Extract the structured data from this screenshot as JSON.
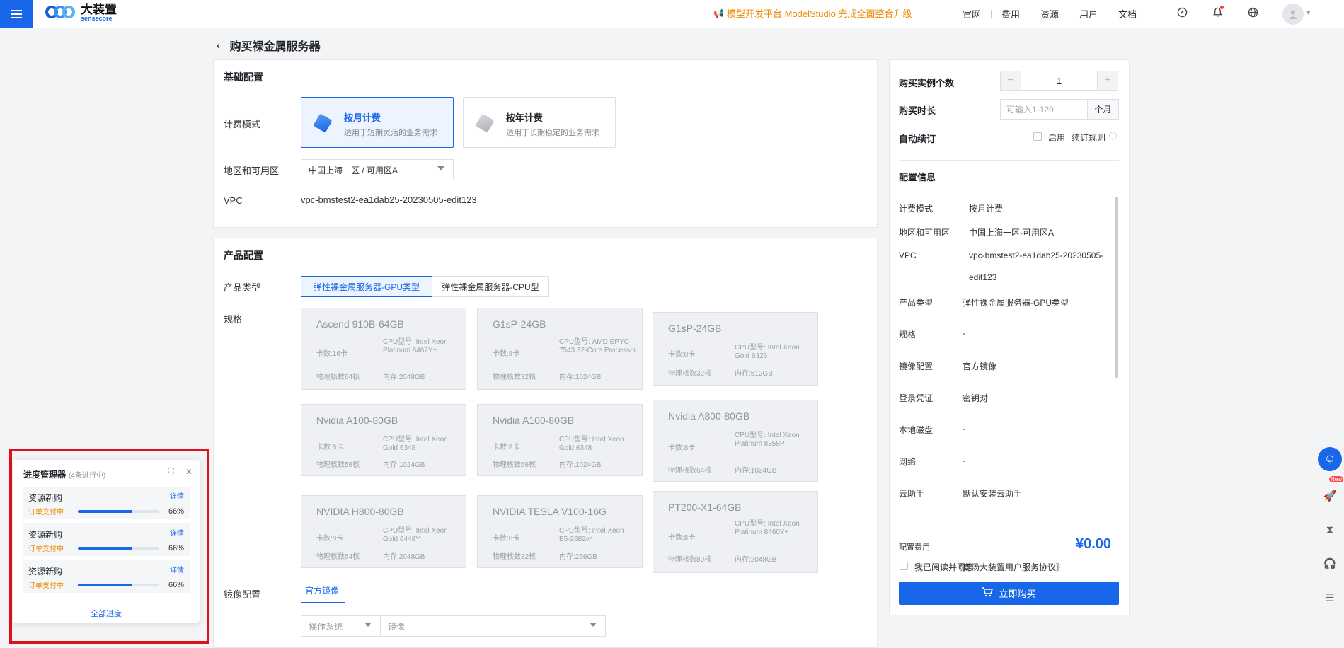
{
  "header": {
    "logo_cn": "大装置",
    "logo_en": "sensecore",
    "announcement": "模型开发平台 ModelStudio 完成全面整合升级",
    "nav": [
      "官网",
      "费用",
      "资源",
      "用户",
      "文档"
    ]
  },
  "page": {
    "title": "购买裸金属服务器"
  },
  "basic": {
    "title": "基础配置",
    "billing_label": "计费模式",
    "monthly_title": "按月计费",
    "monthly_desc": "适用于短期灵活的业务需求",
    "yearly_title": "按年计费",
    "yearly_desc": "适用于长期稳定的业务需求",
    "region_label": "地区和可用区",
    "region_value": "中国上海一区 / 可用区A",
    "vpc_label": "VPC",
    "vpc_value": "vpc-bmstest2-ea1dab25-20230505-edit123"
  },
  "product": {
    "title": "产品配置",
    "type_label": "产品类型",
    "type_gpu": "弹性裸金属服务器-GPU类型",
    "type_cpu": "弹性裸金属服务器-CPU型",
    "spec_label": "规格",
    "specs": [
      {
        "name": "Ascend 910B-64GB",
        "cards": "卡数:16卡",
        "cpu": "CPU型号: Intel Xeon Platinum 8462Y+",
        "cores": "物理核数64核",
        "mem": "内存:2048GB"
      },
      {
        "name": "G1sP-24GB",
        "cards": "卡数:8卡",
        "cpu": "CPU型号: AMD EPYC 7543 32-Core Processor",
        "cores": "物理核数32核",
        "mem": "内存:1024GB"
      },
      {
        "name": "G1sP-24GB",
        "cards": "卡数:8卡",
        "cpu": "CPU型号: Intel Xeon Gold 6326",
        "cores": "物理核数32核",
        "mem": "内存:512GB"
      },
      {
        "name": "Nvidia A100-80GB",
        "cards": "卡数:8卡",
        "cpu": "CPU型号: Intel Xeon Gold 6348",
        "cores": "物理核数56核",
        "mem": "内存:1024GB"
      },
      {
        "name": "Nvidia A100-80GB",
        "cards": "卡数:8卡",
        "cpu": "CPU型号: Intel Xeon Gold 6348",
        "cores": "物理核数56核",
        "mem": "内存:1024GB"
      },
      {
        "name": "Nvidia A800-80GB",
        "cards": "卡数:8卡",
        "cpu": "CPU型号: Intel Xeon Platinum 8358P",
        "cores": "物理核数64核",
        "mem": "内存:1024GB"
      },
      {
        "name": "NVIDIA H800-80GB",
        "cards": "卡数:8卡",
        "cpu": "CPU型号: Intel Xeon Gold 6448Y",
        "cores": "物理核数64核",
        "mem": "内存:2048GB"
      },
      {
        "name": "NVIDIA TESLA V100-16G",
        "cards": "卡数:8卡",
        "cpu": "CPU型号: Intel Xeon E5-2682v4",
        "cores": "物理核数32核",
        "mem": "内存:256GB"
      },
      {
        "name": "PT200-X1-64GB",
        "cards": "卡数:8卡",
        "cpu": "CPU型号: Intel Xeon Platinum 8460Y+",
        "cores": "物理核数80核",
        "mem": "内存:2048GB"
      }
    ],
    "image_label": "镜像配置",
    "image_tab": "官方镜像",
    "os_placeholder": "操作系统",
    "image_placeholder": "镜像"
  },
  "order": {
    "count_label": "购买实例个数",
    "count_value": "1",
    "duration_label": "购买时长",
    "duration_placeholder": "可输入1-120",
    "duration_unit": "个月",
    "renew_label": "自动续订",
    "renew_enable": "启用",
    "renew_rule": "续订规则",
    "config_title": "配置信息",
    "info": [
      {
        "k": "计费模式",
        "v": "按月计费"
      },
      {
        "k": "地区和可用区",
        "v": "中国上海一区-可用区A"
      },
      {
        "k": "VPC",
        "v": "vpc-bmstest2-ea1dab25-20230505-",
        "v2": "edit123"
      },
      {
        "k": "产品类型",
        "v": "弹性裸金属服务器-GPU类型"
      },
      {
        "k": "规格",
        "v": "-"
      },
      {
        "k": "镜像配置",
        "v": "官方镜像"
      },
      {
        "k": "登录凭证",
        "v": "密钥对"
      },
      {
        "k": "本地磁盘",
        "v": "-"
      },
      {
        "k": "网络",
        "v": "-"
      },
      {
        "k": "云助手",
        "v": "默认安装云助手"
      }
    ],
    "fee_label": "配置费用",
    "fee_value": "¥0.00",
    "agree_text": "我已阅读并同意",
    "agree_link": "《商汤大装置用户服务协议》",
    "buy_label": "立即购买"
  },
  "float": {
    "new_badge": "New"
  },
  "progress": {
    "title": "进度管理器",
    "subtitle": "(4条进行中)",
    "items": [
      {
        "name": "资源新购",
        "detail": "详情",
        "status": "订单支付中",
        "percent": 66,
        "percent_text": "66%"
      },
      {
        "name": "资源新购",
        "detail": "详情",
        "status": "订单支付中",
        "percent": 66,
        "percent_text": "66%"
      },
      {
        "name": "资源新购",
        "detail": "详情",
        "status": "订单支付中",
        "percent": 66,
        "percent_text": "66%"
      }
    ],
    "all_label": "全部进度"
  },
  "colors": {
    "primary": "#1767e8",
    "warning": "#f08a00",
    "highlight_frame": "#e0111a"
  }
}
